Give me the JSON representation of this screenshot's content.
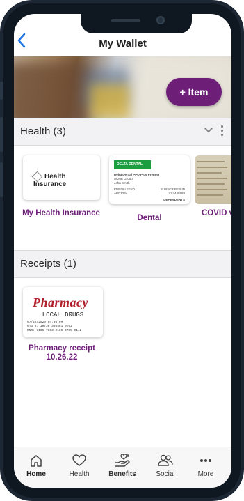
{
  "header": {
    "title": "My Wallet",
    "back_icon": "back-chevron-icon"
  },
  "hero": {
    "add_button_label": "+ Item",
    "accent_color": "#6d1f78"
  },
  "health_section": {
    "title": "Health (3)",
    "cards": [
      {
        "label": "My Health Insurance",
        "logo_text": "Health Insurance"
      },
      {
        "label": "Dental",
        "badge": "DELTA DENTAL",
        "lines": [
          "Delta Dental PPO Plus Premier",
          "ACME Group",
          "John Smith"
        ],
        "fields": [
          "ENROLLEE ID",
          "ABC1234",
          "SUBSCRIBER ID",
          "YY4448888",
          "DEPENDENTS"
        ]
      },
      {
        "label": "COVID vac"
      }
    ]
  },
  "receipts_section": {
    "title": "Receipts (1)",
    "cards": [
      {
        "label": "Pharmacy receipt 10.26.22",
        "store": "Pharmacy",
        "subtitle": "LOCAL DRUGS",
        "lines": [
          "07/22/2020   04:36 PM",
          "6T3   5:   10738    386461     9T62",
          "RNR:        7105-7863-2109-3705-0142"
        ]
      }
    ]
  },
  "tabbar": {
    "tabs": [
      {
        "label": "Home",
        "icon": "home-icon"
      },
      {
        "label": "Health",
        "icon": "heart-icon"
      },
      {
        "label": "Benefits",
        "icon": "hand-heart-icon"
      },
      {
        "label": "Social",
        "icon": "people-icon"
      },
      {
        "label": "More",
        "icon": "more-dots-icon"
      }
    ]
  }
}
